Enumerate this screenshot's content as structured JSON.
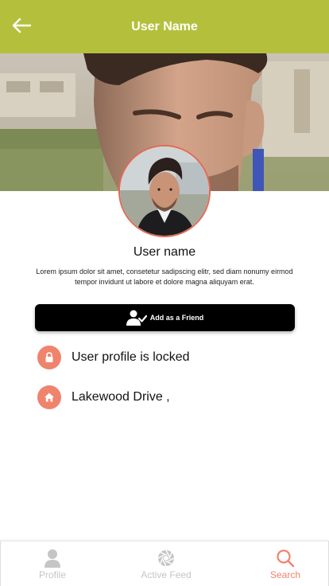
{
  "header": {
    "title": "User Name",
    "back_icon": "arrow-left-icon"
  },
  "profile": {
    "name": "User name",
    "bio": "Lorem ipsum dolor sit amet, consetetur sadipscing elitr, sed diam nonumy eirmod tempor invidunt ut labore et dolore magna aliquyam erat."
  },
  "actions": {
    "add_friend_label": "Add as a Friend",
    "add_friend_icon": "user-check-icon"
  },
  "info": [
    {
      "icon": "lock-icon",
      "text": "User profile is locked"
    },
    {
      "icon": "home-icon",
      "text": "Lakewood Drive ,"
    }
  ],
  "bottom_nav": [
    {
      "label": "Profile",
      "icon": "person-icon",
      "active": false
    },
    {
      "label": "Active Feed",
      "icon": "aperture-icon",
      "active": false
    },
    {
      "label": "Search",
      "icon": "search-icon",
      "active": true
    }
  ],
  "colors": {
    "header_bg": "#b4c03c",
    "accent": "#f0836c",
    "button_bg": "#000000",
    "nav_inactive": "#c5c5c5"
  }
}
